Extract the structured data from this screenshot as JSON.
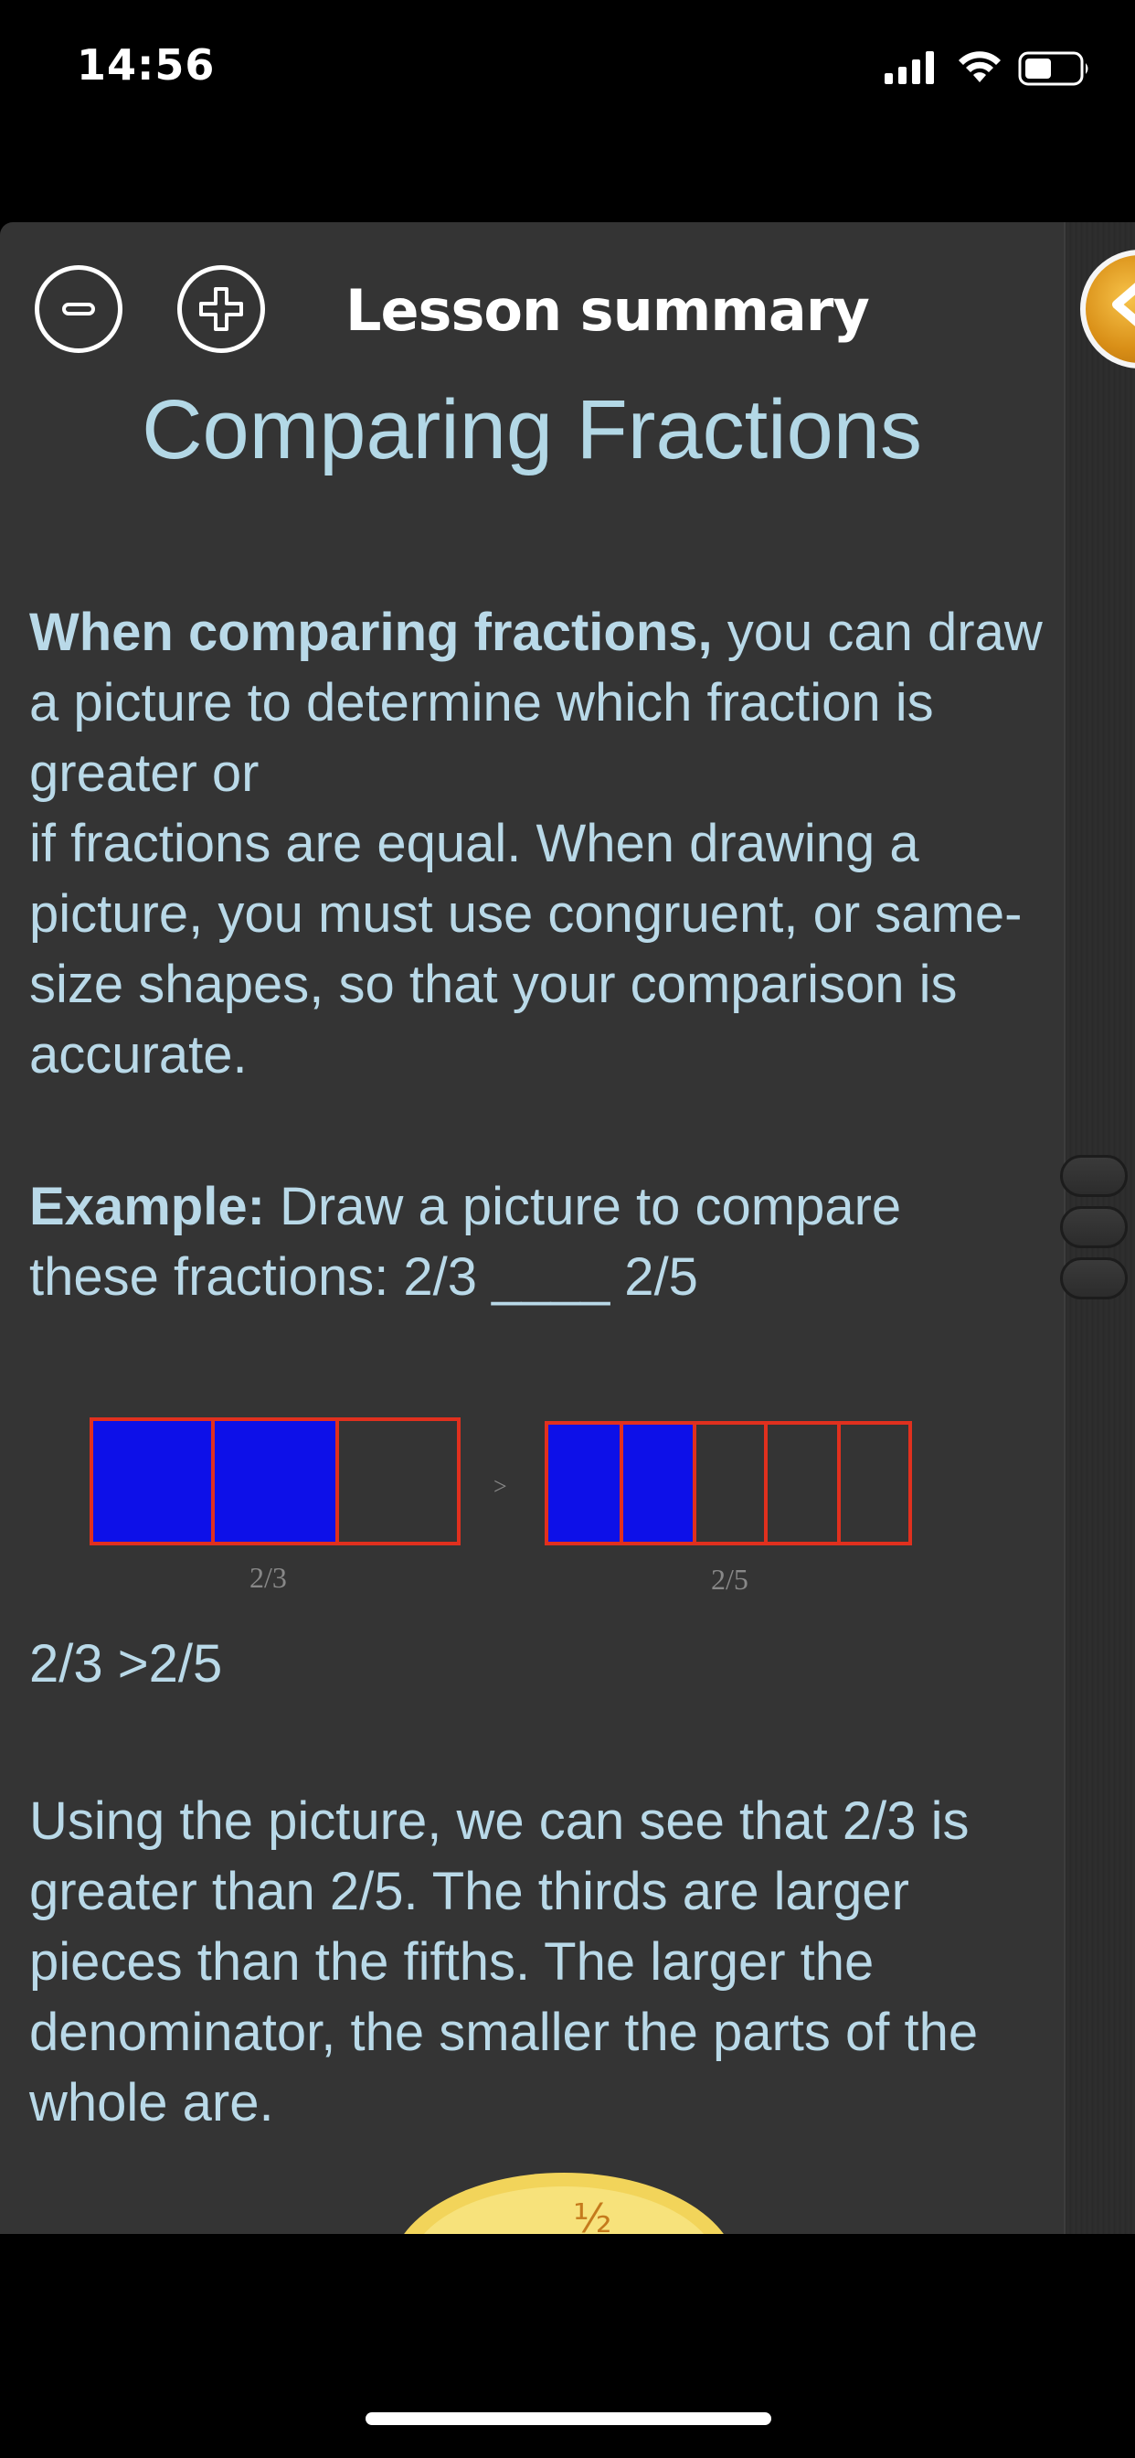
{
  "status_bar": {
    "time": "14:56",
    "icons": [
      "signal-icon",
      "wifi-icon",
      "battery-icon"
    ]
  },
  "toolbar": {
    "zoom_out_icon": "minus-circle-icon",
    "zoom_in_icon": "plus-circle-icon",
    "title": "Lesson summary",
    "side_tab_icon": "chevron-left-icon"
  },
  "lesson": {
    "title": "Comparing Fractions",
    "intro_bold": "When comparing fractions,",
    "intro_rest": " you can draw a picture to determine which fraction is greater or",
    "intro_line2": "if fractions are equal.  When drawing a picture, you must use congruent, or same-size shapes, so that your comparison is accurate.",
    "example_bold": "Example:",
    "example_rest": " Draw a picture to compare these fractions: 2/3 ____ 2/5",
    "result": "2/3 >2/5",
    "explanation": "Using the picture, we can see that 2/3 is greater than 2/5.  The thirds are larger pieces than the fifths.  The larger the denominator,  the smaller the parts of the whole are."
  },
  "figure": {
    "left_label": "2/3",
    "right_label": "2/5",
    "comparison_sign": ">",
    "fill_color": "#0d10e8",
    "border_color": "#e0301e",
    "left_fraction": {
      "numerator": 2,
      "denominator": 3
    },
    "right_fraction": {
      "numerator": 2,
      "denominator": 5
    }
  },
  "bottom_image": {
    "label": "½"
  },
  "colors": {
    "panel_background": "#343434",
    "text": "#b9d9e8",
    "title_white": "#ffffff",
    "badge_orange": "#e39a1d"
  }
}
